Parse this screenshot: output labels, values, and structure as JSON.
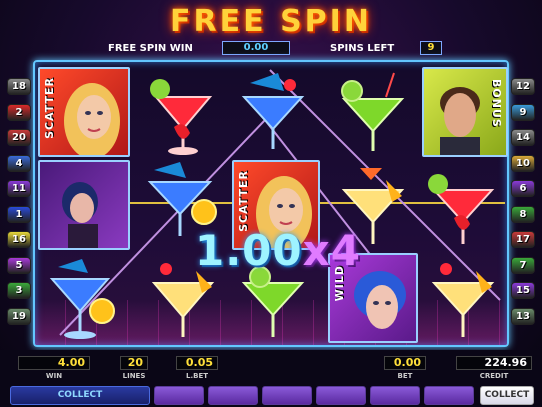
{
  "header": {
    "title": "FREE SPIN"
  },
  "info": {
    "free_spin_win_label": "FREE SPIN WIN",
    "free_spin_win_value": "0.00",
    "spins_left_label": "SPINS LEFT",
    "spins_left_value": "9"
  },
  "paylines_left": [
    "18",
    "2",
    "20",
    "4",
    "11",
    "1",
    "16",
    "5",
    "3",
    "19"
  ],
  "paylines_right": [
    "12",
    "9",
    "14",
    "10",
    "6",
    "8",
    "17",
    "7",
    "15",
    "13"
  ],
  "symbols": {
    "scatter": "SCATTER",
    "bonus": "BONUS",
    "wild": "WILD"
  },
  "win_display": {
    "amount": "1.00",
    "times": "x",
    "count": "4"
  },
  "bottom": {
    "win_value": "4.00",
    "win_caption": "WIN",
    "lines_value": "20",
    "lines_caption": "LINES",
    "lbet_value": "0.05",
    "lbet_caption": "L.BET",
    "bet_value": "0.00",
    "bet_caption": "BET",
    "credit_value": "224.96",
    "credit_caption": "CREDIT"
  },
  "buttons": {
    "collect_main": "COLLECT",
    "collect_side": "COLLECT"
  },
  "colors": {
    "title": "#ffd23a",
    "frame": "#63c7ff",
    "value_text": "#ffe03a"
  }
}
